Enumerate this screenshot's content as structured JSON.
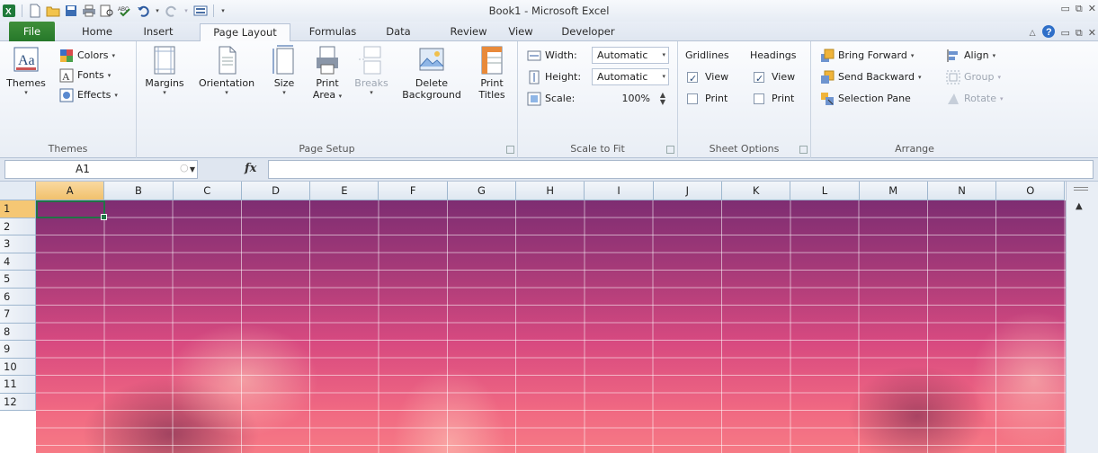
{
  "window": {
    "title": "Book1 - Microsoft Excel"
  },
  "tabs": [
    {
      "label": "File"
    },
    {
      "label": "Home"
    },
    {
      "label": "Insert"
    },
    {
      "label": "Page Layout"
    },
    {
      "label": "Formulas"
    },
    {
      "label": "Data"
    },
    {
      "label": "Review"
    },
    {
      "label": "View"
    },
    {
      "label": "Developer"
    }
  ],
  "active_tab": "Page Layout",
  "ribbon": {
    "themes": {
      "group_label": "Themes",
      "themes_btn": "Themes",
      "colors": "Colors",
      "fonts": "Fonts",
      "effects": "Effects"
    },
    "page_setup": {
      "group_label": "Page Setup",
      "margins": "Margins",
      "orientation": "Orientation",
      "size": "Size",
      "print_area_1": "Print",
      "print_area_2": "Area",
      "breaks": "Breaks",
      "delete_bg_1": "Delete",
      "delete_bg_2": "Background",
      "print_titles_1": "Print",
      "print_titles_2": "Titles"
    },
    "scale_to_fit": {
      "group_label": "Scale to Fit",
      "width_label": "Width:",
      "width_value": "Automatic",
      "height_label": "Height:",
      "height_value": "Automatic",
      "scale_label": "Scale:",
      "scale_value": "100%"
    },
    "sheet_options": {
      "group_label": "Sheet Options",
      "gridlines": "Gridlines",
      "headings": "Headings",
      "view": "View",
      "print": "Print",
      "gridlines_view": true,
      "gridlines_print": false,
      "headings_view": true,
      "headings_print": false
    },
    "arrange": {
      "group_label": "Arrange",
      "bring_forward": "Bring Forward",
      "send_backward": "Send Backward",
      "selection_pane": "Selection Pane",
      "align": "Align",
      "group": "Group",
      "rotate": "Rotate"
    }
  },
  "formula_bar": {
    "name_box": "A1",
    "fx": "fx",
    "formula": ""
  },
  "grid": {
    "columns": [
      "A",
      "B",
      "C",
      "D",
      "E",
      "F",
      "G",
      "H",
      "I",
      "J",
      "K",
      "L",
      "M",
      "N",
      "O"
    ],
    "rows": [
      "1",
      "2",
      "3",
      "4",
      "5",
      "6",
      "7",
      "8",
      "9",
      "10",
      "11",
      "12"
    ],
    "active_cell": "A1"
  },
  "colors": {
    "file_tab": "#2e8232",
    "active_cell_border": "#217346",
    "header_highlight": "#f5c774"
  }
}
